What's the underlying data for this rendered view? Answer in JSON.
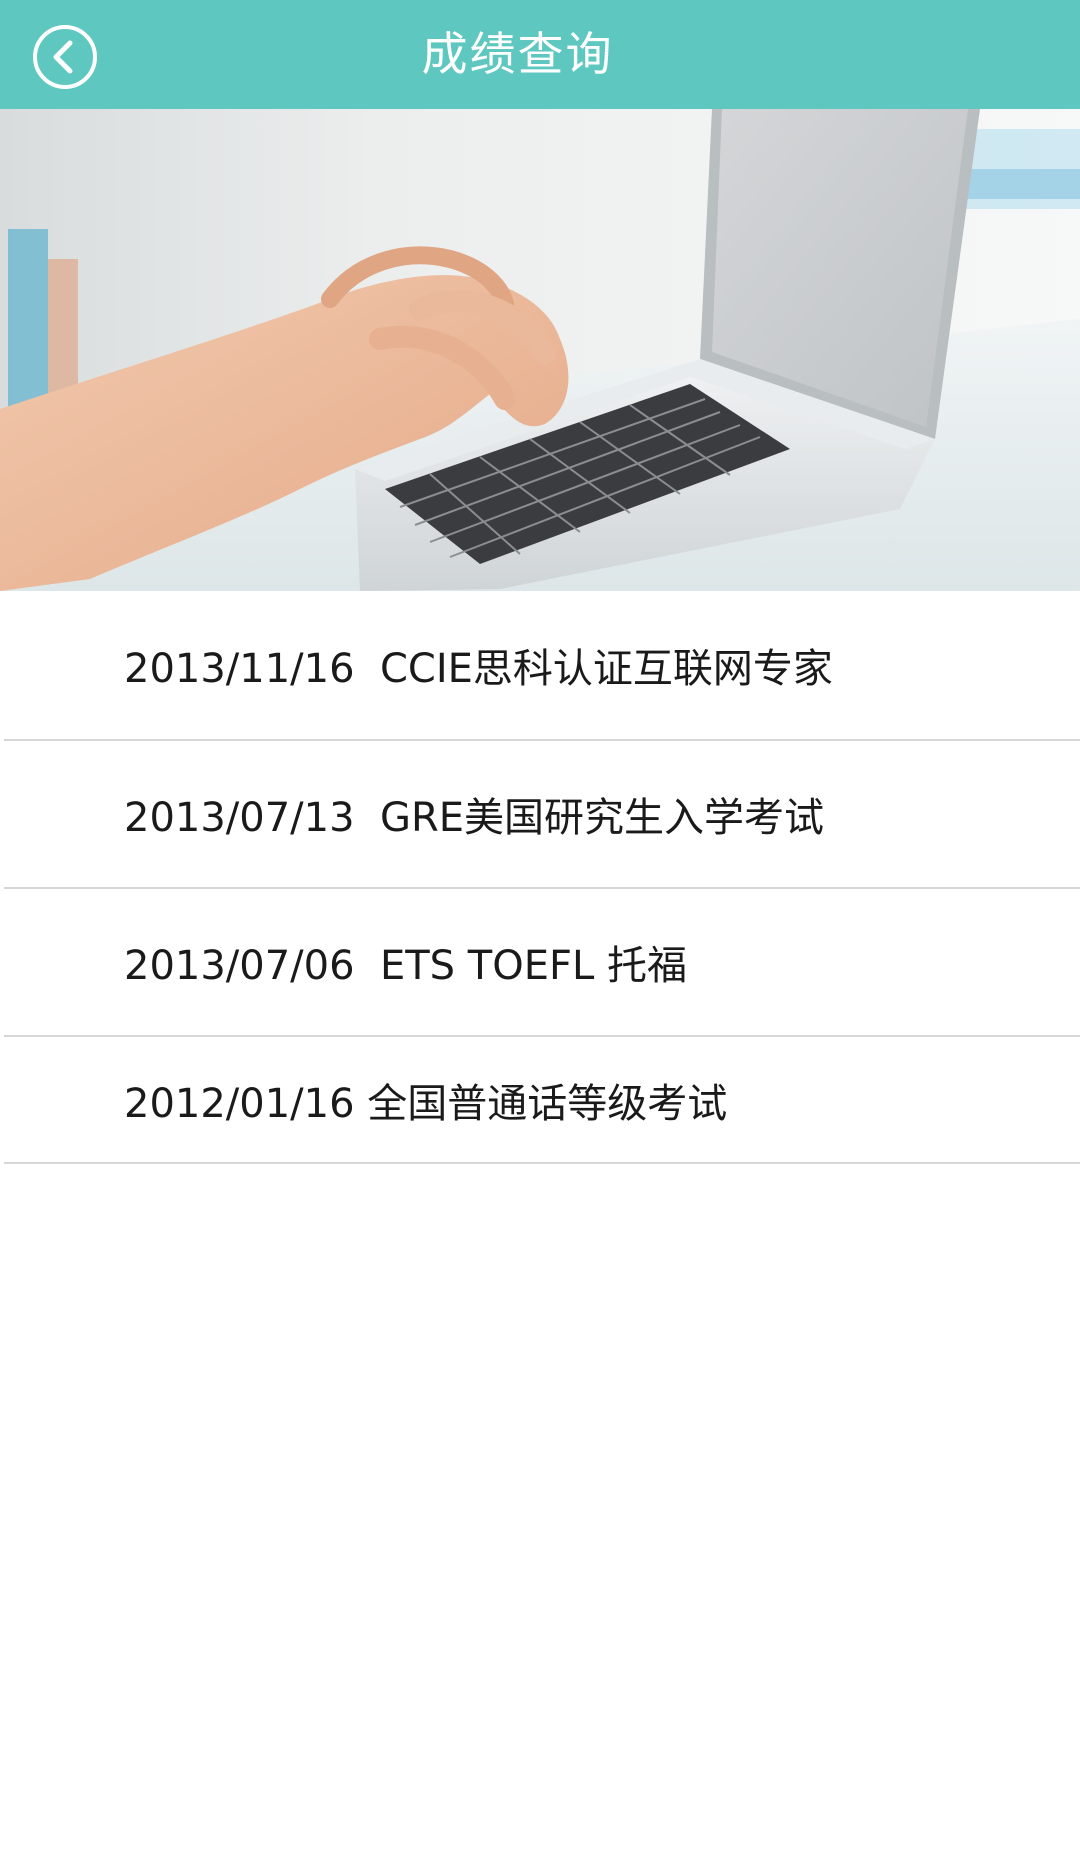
{
  "header": {
    "title": "成绩查询",
    "back_icon": "chevron-left-circle-icon",
    "background": "#5ec8c0"
  },
  "hero": {
    "image": "laptop-typing-photo"
  },
  "records": [
    {
      "text": "2013/11/16  CCIE思科认证互联网专家"
    },
    {
      "text": "2013/07/13  GRE美国研究生入学考试"
    },
    {
      "text": "2013/07/06  ETS TOEFL 托福"
    },
    {
      "text": "2012/01/16 全国普通话等级考试"
    }
  ]
}
